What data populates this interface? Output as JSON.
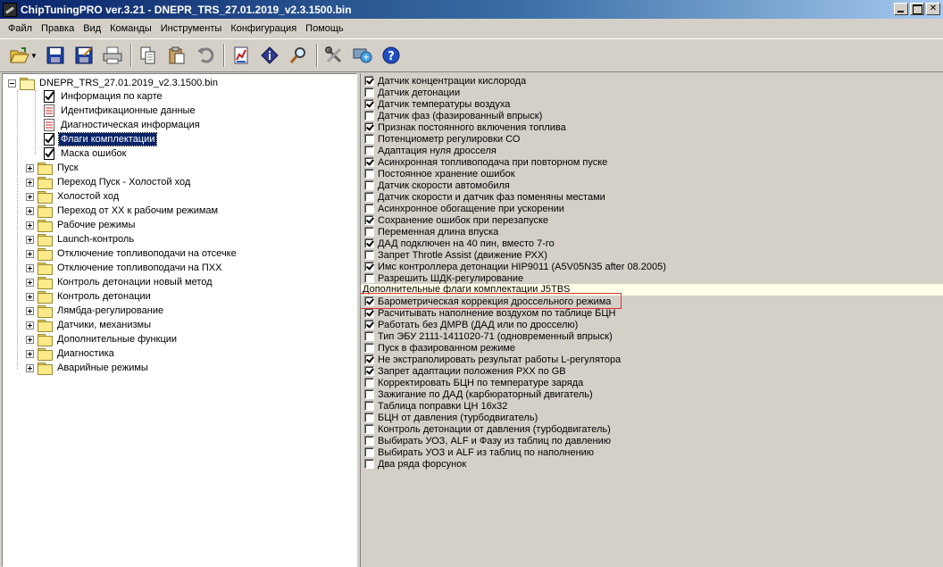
{
  "window": {
    "title": "ChipTuningPRO ver.3.21 - DNEPR_TRS_27.01.2019_v2.3.1500.bin"
  },
  "menu": [
    "Файл",
    "Правка",
    "Вид",
    "Команды",
    "Инструменты",
    "Конфигурация",
    "Помощь"
  ],
  "toolbar": {
    "icons": [
      "open-icon",
      "save-icon",
      "save-as-icon",
      "print-icon",
      "copy-icon",
      "paste-icon",
      "undo-icon",
      "report-icon",
      "info-icon",
      "search-icon",
      "tools-icon",
      "update-icon",
      "help-icon"
    ]
  },
  "tree": {
    "root": "DNEPR_TRS_27.01.2019_v2.3.1500.bin",
    "docs": [
      "Информация по карте",
      "Идентификационные данные",
      "Диагностическая информация",
      "Флаги комплектации",
      "Маска ошибок"
    ],
    "selected": "Флаги комплектации",
    "folders": [
      "Пуск",
      "Переход Пуск - Холостой ход",
      "Холостой ход",
      "Переход от ХХ к рабочим режимам",
      "Рабочие режимы",
      "Launch-контроль",
      "Отключение топливоподачи на отсечке",
      "Отключение топливоподачи на ПХХ",
      "Контроль детонации новый метод",
      "Контроль детонации",
      "Лямбда-регулирование",
      "Датчики, механизмы",
      "Дополнительные функции",
      "Диагностика",
      "Аварийные режимы"
    ]
  },
  "flags": [
    {
      "label": "Датчик концентрации кислорода",
      "checked": true
    },
    {
      "label": "Датчик детонации",
      "checked": false
    },
    {
      "label": "Датчик температуры воздуха",
      "checked": true
    },
    {
      "label": "Датчик фаз (фазированный впрыск)",
      "checked": false
    },
    {
      "label": "Признак постоянного включения топлива",
      "checked": true
    },
    {
      "label": "Потенциометр регулировки СО",
      "checked": false
    },
    {
      "label": "Адаптация нуля дросселя",
      "checked": false
    },
    {
      "label": "Асинхронная топливоподача при повторном пуске",
      "checked": true
    },
    {
      "label": "Постоянное хранение ошибок",
      "checked": false
    },
    {
      "label": "Датчик скорости автомобиля",
      "checked": false
    },
    {
      "label": "Датчик скорости и датчик фаз поменяны местами",
      "checked": false
    },
    {
      "label": "Асинхронное обогащение при ускорении",
      "checked": false
    },
    {
      "label": "Сохранение ошибок при перезапуске",
      "checked": true
    },
    {
      "label": "Переменная длина впуска",
      "checked": false
    },
    {
      "label": "ДАД подключен на 40 пин, вместо 7-го",
      "checked": true
    },
    {
      "label": "Запрет Throtle Assist (движение РХХ)",
      "checked": false
    },
    {
      "label": "Имс контроллера детонации HIP9011 (A5V05N35 after 08.2005)",
      "checked": true
    },
    {
      "label": "Разрешить ШДК-регулирование",
      "checked": false
    }
  ],
  "extra_group_title": "Дополнительные флаги комплектации J5TBS",
  "extra_flags": [
    {
      "label": "Барометрическая коррекция дроссельного режима",
      "checked": true
    },
    {
      "label": "Расчитывать наполнение воздухом по таблице БЦН",
      "checked": true
    },
    {
      "label": "Работать без ДМРВ (ДАД или по дросселю)",
      "checked": true
    },
    {
      "label": "Тип ЭБУ 2111-1411020-71 (одновременный впрыск)",
      "checked": false
    },
    {
      "label": "Пуск в фазированном режиме",
      "checked": false
    },
    {
      "label": "Не экстраполировать результат работы L-регулятора",
      "checked": true
    },
    {
      "label": "Запрет адаптации положения РХХ по GB",
      "checked": true
    },
    {
      "label": "Корректировать БЦН по температуре заряда",
      "checked": false
    },
    {
      "label": "Зажигание по ДАД (карбюраторный двигатель)",
      "checked": false
    },
    {
      "label": "Таблица поправки ЦН 16x32",
      "checked": false
    },
    {
      "label": "БЦН от давления (турбодвигатель)",
      "checked": false
    },
    {
      "label": "Контроль детонации от давления (турбодвигатель)",
      "checked": false
    },
    {
      "label": "Выбирать УОЗ, ALF и Фазу из таблиц по давлению",
      "checked": false
    },
    {
      "label": "Выбирать УОЗ и ALF из таблиц по наполнению",
      "checked": false
    },
    {
      "label": "Два ряда форсунок",
      "checked": false
    }
  ],
  "highlight_color": "#e03030"
}
